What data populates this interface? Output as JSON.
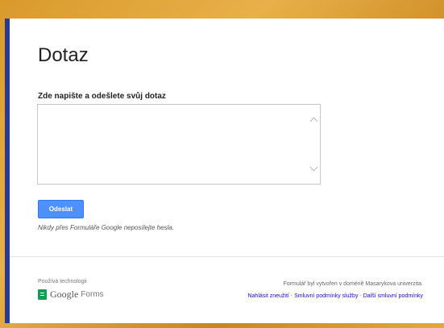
{
  "form": {
    "title": "Dotaz",
    "question_label": "Zde napište a odešlete svůj dotaz",
    "answer_value": "",
    "submit_label": "Odeslat",
    "password_warning": "Nikdy přes Formuláře Google neposílejte hesla."
  },
  "footer": {
    "powered_by": "Používá technologii",
    "logo_google": "Google",
    "logo_forms": "Forms",
    "created_in": "Formulář byl vytvořen v doméně Masarykova univerzita.",
    "links": [
      {
        "label": "Nahlásit zneužití"
      },
      {
        "label": "Smluvní podmínky služby"
      },
      {
        "label": "Další smluvní podmínky"
      }
    ],
    "separator": " - "
  },
  "colors": {
    "accent_blue": "#4d90fe",
    "side_stripe": "#2b3a8f",
    "link": "#1a0dab",
    "forms_green": "#0f9d58"
  }
}
